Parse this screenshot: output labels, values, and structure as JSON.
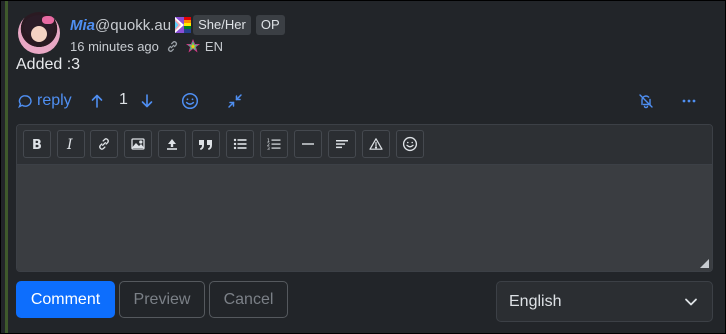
{
  "comment": {
    "author": {
      "name": "Mia",
      "instance": "@quokk.au",
      "pronouns_badge": "She/Her",
      "op_badge": "OP"
    },
    "timestamp": "16 minutes ago",
    "language_code": "EN",
    "body": "Added :3",
    "vote_count": "1"
  },
  "actions": {
    "reply_label": "reply",
    "icons": [
      "reply-icon",
      "upvote-icon",
      "downvote-icon",
      "emoji-icon",
      "collapse-icon",
      "mute-icon",
      "more-icon"
    ]
  },
  "editor": {
    "toolbar_icons": [
      "bold-icon",
      "italic-icon",
      "link-icon",
      "image-icon",
      "upload-icon",
      "quote-icon",
      "bullet-list-icon",
      "numbered-list-icon",
      "horizontal-rule-icon",
      "subscript-icon",
      "spoiler-warning-icon",
      "emoji-icon"
    ],
    "textarea_value": "",
    "textarea_placeholder": ""
  },
  "buttons": {
    "comment": "Comment",
    "preview": "Preview",
    "cancel": "Cancel"
  },
  "language_select": {
    "selected": "English"
  },
  "colors": {
    "accent": "#4f8ff2",
    "primary_button": "#0d6efd",
    "background": "#222529"
  }
}
